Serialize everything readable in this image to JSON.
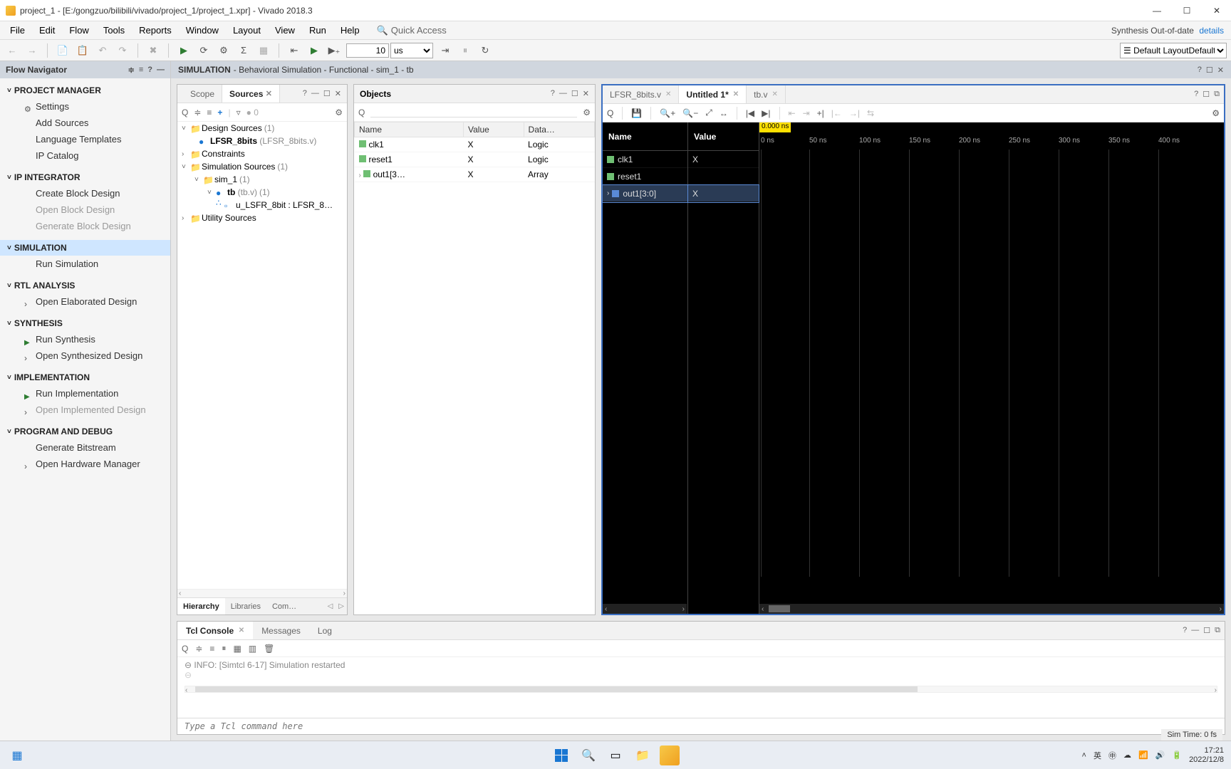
{
  "titlebar": {
    "title": "project_1 - [E:/gongzuo/bilibili/vivado/project_1/project_1.xpr] - Vivado 2018.3"
  },
  "menu": {
    "items": [
      "File",
      "Edit",
      "Flow",
      "Tools",
      "Reports",
      "Window",
      "Layout",
      "View",
      "Run",
      "Help"
    ],
    "quick_access": "Quick Access",
    "syn_status": "Synthesis Out-of-date",
    "details": "details"
  },
  "toolbar": {
    "time_value": "10",
    "time_unit": "us",
    "layout": "Default Layout"
  },
  "flow_nav": {
    "title": "Flow Navigator",
    "project_manager": {
      "title": "PROJECT MANAGER",
      "items": [
        "Settings",
        "Add Sources",
        "Language Templates",
        "IP Catalog"
      ]
    },
    "ip_integrator": {
      "title": "IP INTEGRATOR",
      "items": [
        "Create Block Design",
        "Open Block Design",
        "Generate Block Design"
      ]
    },
    "simulation": {
      "title": "SIMULATION",
      "items": [
        "Run Simulation"
      ]
    },
    "rtl": {
      "title": "RTL ANALYSIS",
      "items": [
        "Open Elaborated Design"
      ]
    },
    "synthesis": {
      "title": "SYNTHESIS",
      "items": [
        "Run Synthesis",
        "Open Synthesized Design"
      ]
    },
    "implementation": {
      "title": "IMPLEMENTATION",
      "items": [
        "Run Implementation",
        "Open Implemented Design"
      ]
    },
    "program": {
      "title": "PROGRAM AND DEBUG",
      "items": [
        "Generate Bitstream",
        "Open Hardware Manager"
      ]
    }
  },
  "sim_header": {
    "bold": "SIMULATION",
    "rest": " - Behavioral Simulation - Functional - sim_1 - tb"
  },
  "sources": {
    "tabs": {
      "scope": "Scope",
      "sources": "Sources"
    },
    "count_badge": "0",
    "tree": {
      "design_sources": {
        "label": "Design Sources",
        "count": "(1)",
        "child": {
          "label": "LFSR_8bits",
          "suffix": "(LFSR_8bits.v)"
        }
      },
      "constraints": {
        "label": "Constraints"
      },
      "sim_sources": {
        "label": "Simulation Sources",
        "count": "(1)",
        "sim1": {
          "label": "sim_1",
          "count": "(1)",
          "tb": {
            "label": "tb",
            "suffix": "(tb.v)",
            "count": "(1)",
            "inst": {
              "label": "u_LSFR_8bit : LFSR_8…"
            }
          }
        }
      },
      "utility": {
        "label": "Utility Sources"
      }
    },
    "bottom_tabs": [
      "Hierarchy",
      "Libraries",
      "Com…"
    ]
  },
  "objects": {
    "title": "Objects",
    "cols": {
      "name": "Name",
      "value": "Value",
      "dtype": "Data…"
    },
    "rows": [
      {
        "name": "clk1",
        "value": "X",
        "dtype": "Logic"
      },
      {
        "name": "reset1",
        "value": "X",
        "dtype": "Logic"
      },
      {
        "name": "out1[3…",
        "value": "X",
        "dtype": "Array"
      }
    ]
  },
  "wave": {
    "tabs": [
      {
        "label": "LFSR_8bits.v",
        "active": false
      },
      {
        "label": "Untitled 1*",
        "active": true
      },
      {
        "label": "tb.v",
        "active": false
      }
    ],
    "cols": {
      "name": "Name",
      "value": "Value"
    },
    "cursor_time": "0.000 ns",
    "ticks": [
      "0 ns",
      "50 ns",
      "100 ns",
      "150 ns",
      "200 ns",
      "250 ns",
      "300 ns",
      "350 ns",
      "400 ns"
    ],
    "signals": [
      {
        "name": "clk1",
        "value": "X",
        "bus": false
      },
      {
        "name": "reset1",
        "value": "",
        "bus": false
      },
      {
        "name": "out1[3:0]",
        "value": "X",
        "bus": true,
        "selected": true,
        "expandable": true
      }
    ]
  },
  "console": {
    "tabs": [
      "Tcl Console",
      "Messages",
      "Log"
    ],
    "msg": "INFO: [Simtcl 6-17] Simulation restarted",
    "input_placeholder": "Type a Tcl command here"
  },
  "status": {
    "simtime": "Sim Time: 0 fs"
  },
  "taskbar": {
    "time": "17:21",
    "date": "2022/12/8",
    "lang": "英",
    "tray_icons": [
      "chevron-up-icon",
      "ime-icon",
      "onedrive-icon",
      "wifi-icon",
      "volume-icon",
      "battery-icon"
    ]
  }
}
